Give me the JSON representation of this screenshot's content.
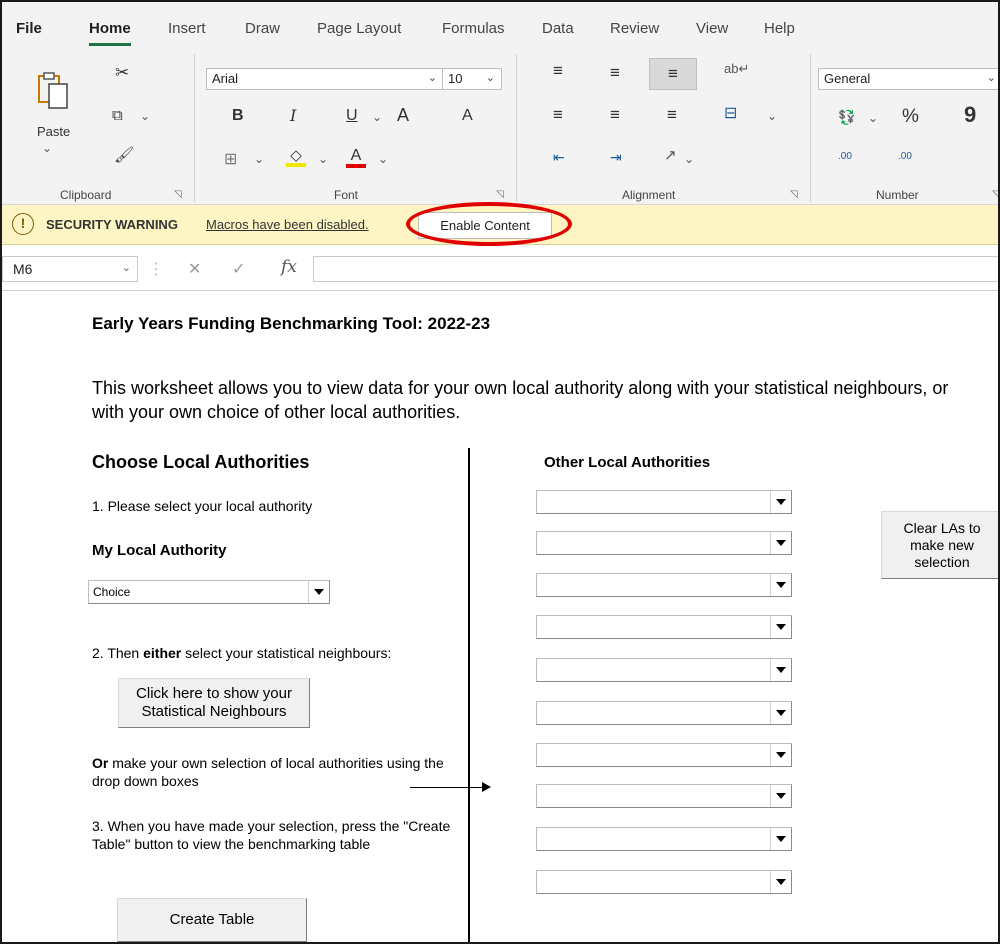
{
  "ribbon_tabs": [
    "File",
    "Home",
    "Insert",
    "Draw",
    "Page Layout",
    "Formulas",
    "Data",
    "Review",
    "View",
    "Help"
  ],
  "clipboard": {
    "paste_label": "Paste",
    "group_label": "Clipboard"
  },
  "font": {
    "name": "Arial",
    "size": "10",
    "group_label": "Font",
    "bold": "B",
    "italic": "I",
    "underline": "U",
    "grow": "A",
    "shrink": "A",
    "color_letter": "A"
  },
  "alignment": {
    "group_label": "Alignment"
  },
  "number": {
    "format": "General",
    "group_label": "Number",
    "percent": "%",
    "comma": "9",
    "inc_decimal": ".00",
    "dec_decimal": ".00"
  },
  "security": {
    "title": "SECURITY WARNING",
    "message": "Macros have been disabled.",
    "button": "Enable Content",
    "icon_glyph": "!"
  },
  "formula_bar": {
    "name_box": "M6",
    "fx": "fx",
    "formula": ""
  },
  "sheet": {
    "title": "Early Years Funding Benchmarking Tool: 2022-23",
    "intro": "This worksheet allows you to view data for your own local authority along with your statistical neighbours, or with your own choice of other local authorities.",
    "choose_heading": "Choose Local Authorities",
    "other_heading": "Other Local Authorities",
    "step1": "1. Please select your local authority",
    "my_la_heading": "My Local Authority",
    "my_la_value": "Choice",
    "step2_prefix": "2. Then ",
    "step2_bold": "either",
    "step2_suffix": " select your statistical neighbours:",
    "sn_button": "Click here to show your Statistical Neighbours",
    "or_bold": "Or",
    "or_text": " make your own selection of local authorities using the drop down boxes",
    "step3": "3. When you have made your selection, press the \"Create Table\" button to view the benchmarking table",
    "create_button": "Create Table",
    "clear_button": "Clear LAs to make new selection",
    "other_la_values": [
      "",
      "",
      "",
      "",
      "",
      "",
      "",
      "",
      "",
      ""
    ]
  },
  "colors": {
    "accent": "#217346",
    "warning_bg": "#fdf5c3",
    "highlight": "#e10000"
  }
}
